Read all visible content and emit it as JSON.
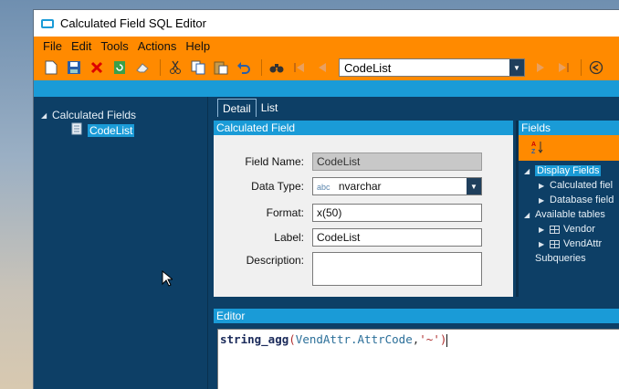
{
  "window": {
    "title": "Calculated Field SQL Editor"
  },
  "menu": [
    "File",
    "Edit",
    "Tools",
    "Actions",
    "Help"
  ],
  "toolbar": {
    "record_selector": "CodeList",
    "icons": [
      "new-icon",
      "save-icon",
      "delete-icon",
      "refresh-icon",
      "eraser-icon",
      "cut-icon",
      "copy-icon",
      "paste-icon",
      "undo-icon",
      "find-icon",
      "first-icon",
      "prev-icon",
      "next-icon",
      "last-icon",
      "back-icon"
    ]
  },
  "tree": {
    "root": "Calculated Fields",
    "child": "CodeList"
  },
  "tabs": {
    "detail": "Detail",
    "list": "List"
  },
  "calc_panel": {
    "header": "Calculated Field",
    "field_name_label": "Field Name:",
    "field_name": "CodeList",
    "data_type_label": "Data Type:",
    "data_type_tag": "abc",
    "data_type": "nvarchar",
    "format_label": "Format:",
    "format": "x(50)",
    "label_label": "Label:",
    "label": "CodeList",
    "description_label": "Description:",
    "description": ""
  },
  "fields_panel": {
    "header": "Fields",
    "display_fields": "Display Fields",
    "calculated_fields": "Calculated fiel",
    "database_fields": "Database field",
    "available_tables": "Available tables",
    "table_vendor": "Vendor",
    "table_vendattr": "VendAttr",
    "subqueries": "Subqueries"
  },
  "editor": {
    "header": "Editor",
    "code_func": "string_agg",
    "code_open": "(",
    "code_arg1": "VendAttr.AttrCode",
    "code_comma": ",",
    "code_arg2": "'~'",
    "code_close": ")"
  }
}
